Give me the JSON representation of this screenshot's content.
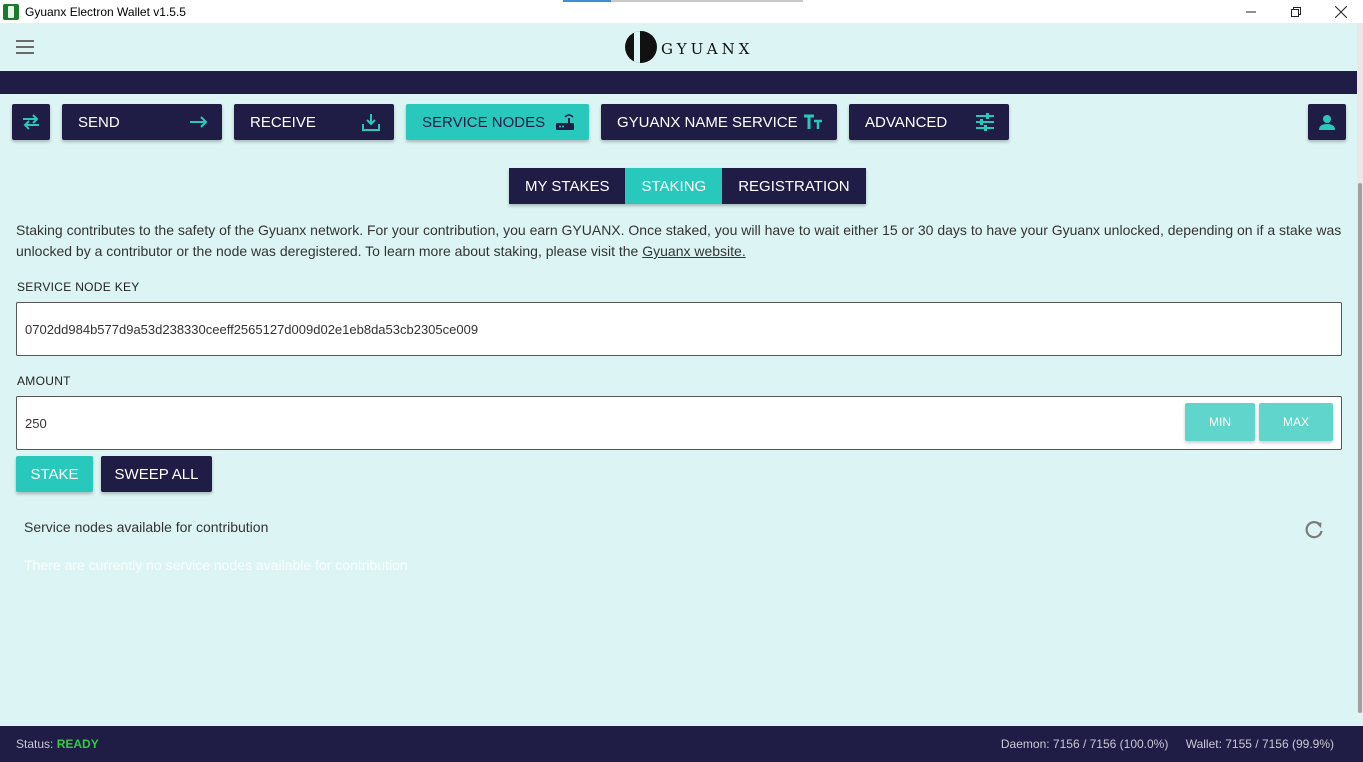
{
  "window": {
    "title": "Gyuanx Electron Wallet v1.5.5",
    "controls": [
      "minimize",
      "restore",
      "close"
    ]
  },
  "header": {
    "logo_text": "GYUANX"
  },
  "nav": {
    "swap_label": "",
    "items": [
      {
        "label": "SEND",
        "icon": "arrow-right-icon"
      },
      {
        "label": "RECEIVE",
        "icon": "download-icon"
      },
      {
        "label": "SERVICE NODES",
        "icon": "router-icon",
        "active": true
      },
      {
        "label": "GYUANX NAME SERVICE",
        "icon": "text-size-icon"
      },
      {
        "label": "ADVANCED",
        "icon": "sliders-icon"
      }
    ]
  },
  "subtabs": [
    {
      "label": "MY STAKES"
    },
    {
      "label": "STAKING",
      "active": true
    },
    {
      "label": "REGISTRATION"
    }
  ],
  "staking": {
    "description": "Staking contributes to the safety of the Gyuanx network. For your contribution, you earn GYUANX. Once staked, you will have to wait either 15 or 30 days to have your Gyuanx unlocked, depending on if a stake was unlocked by a contributor or the node was deregistered. To learn more about staking, please visit the ",
    "link_text": "Gyuanx website.",
    "key_label": "SERVICE NODE KEY",
    "key_value": "0702dd984b577d9a53d238330ceeff2565127d009d02e1eb8da53cb2305ce009",
    "amount_label": "AMOUNT",
    "amount_value": "250",
    "min_label": "MIN",
    "max_label": "MAX",
    "stake_label": "STAKE",
    "sweep_label": "SWEEP ALL"
  },
  "contribution": {
    "title": "Service nodes available for contribution",
    "empty_message": "There are currently no service nodes available for contribution"
  },
  "status": {
    "status_label": "Status:",
    "status_value": "READY",
    "daemon": "Daemon: 7156 / 7156 (100.0%)",
    "wallet": "Wallet: 7155 / 7156 (99.9%)"
  },
  "colors": {
    "navy": "#1f1c46",
    "teal": "#28c8bd",
    "background": "#dcf5f4",
    "ready": "#2ecc40"
  }
}
